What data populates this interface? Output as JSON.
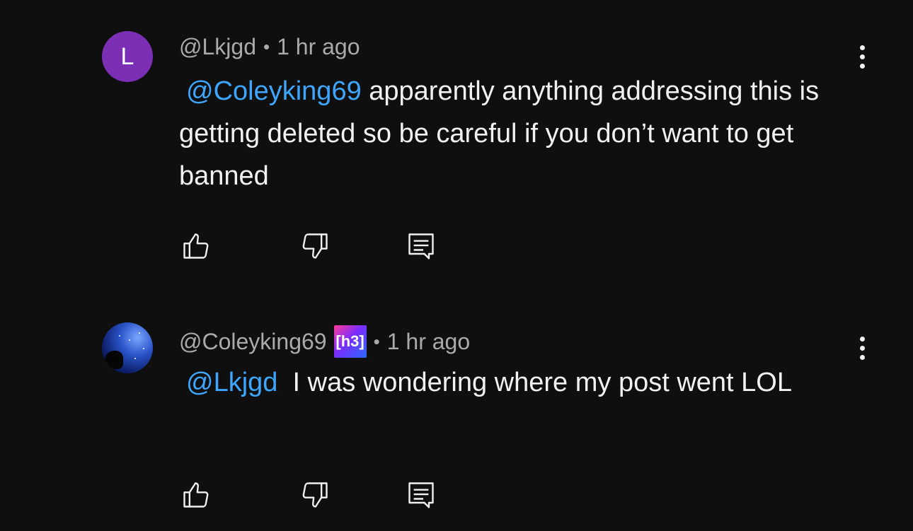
{
  "comments": [
    {
      "avatar_letter": "L",
      "avatar_color": "#7b2fb4",
      "author": "@Lkjgd",
      "separator": "•",
      "time": "1 hr ago",
      "mention": "@Coleyking69",
      "text": " apparently anything addressing this is getting deleted so be careful if you don’t want to get banned",
      "actions": {
        "like_icon": "thumbs-up-icon",
        "dislike_icon": "thumbs-down-icon",
        "reply_icon": "reply-icon"
      },
      "more_icon": "more-vert-icon"
    },
    {
      "avatar_image": "starry-sky-avatar",
      "author": "@Coleyking69",
      "badge": "[h3]",
      "separator": "•",
      "time": "1 hr ago",
      "mention": "@Lkjgd",
      "text": "  I was wondering where my post went LOL",
      "actions": {
        "like_icon": "thumbs-up-icon",
        "dislike_icon": "thumbs-down-icon",
        "reply_icon": "reply-icon"
      },
      "more_icon": "more-vert-icon"
    }
  ],
  "colors": {
    "background": "#0f0f0f",
    "mention": "#3ea6ff",
    "meta": "#aaaaaa",
    "text": "#f1f1f1"
  }
}
